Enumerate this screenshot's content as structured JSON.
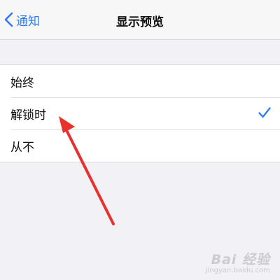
{
  "navbar": {
    "back_label": "通知",
    "title": "显示预览"
  },
  "options": [
    {
      "label": "始终",
      "selected": false
    },
    {
      "label": "解锁时",
      "selected": true
    },
    {
      "label": "从不",
      "selected": false
    }
  ],
  "colors": {
    "accent": "#2f7cf6",
    "annotation_arrow": "#e8302c",
    "background": "#f1f1f6"
  },
  "watermark": {
    "main": "Bai 经验",
    "sub": "jingyan.baidu.com"
  }
}
